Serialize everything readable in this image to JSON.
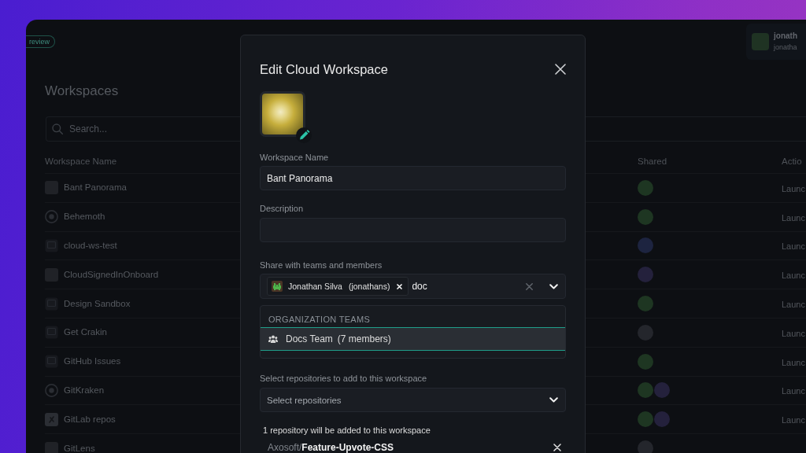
{
  "header": {
    "tag": "review",
    "user": {
      "name": "jonath",
      "handle": "jonatha"
    }
  },
  "page": {
    "title": "Workspaces",
    "search": {
      "placeholder": "Search..."
    }
  },
  "table": {
    "columns": [
      "Workspace Name",
      "Shared",
      "Actio"
    ],
    "rows": [
      {
        "name": "Bant Panorama",
        "kind": "photo",
        "shared": [
          {
            "color": "#1e3622"
          }
        ],
        "action": "Launc"
      },
      {
        "name": "Behemoth",
        "kind": "ring",
        "shared": [
          {
            "color": "#1e3622"
          }
        ],
        "action": "Launc"
      },
      {
        "name": "cloud-ws-test",
        "kind": "box",
        "shared": [
          {
            "color": "#1d2440"
          }
        ],
        "action": "Launc"
      },
      {
        "name": "CloudSignedInOnboard",
        "kind": "photo",
        "shared": [
          {
            "color": "#24213c"
          }
        ],
        "action": "Launc"
      },
      {
        "name": "Design Sandbox",
        "kind": "box",
        "shared": [
          {
            "color": "#1e3622"
          }
        ],
        "action": "Launc"
      },
      {
        "name": "Get Crakin",
        "kind": "box",
        "shared": [
          {
            "color": "#24262c"
          }
        ],
        "action": "Launc"
      },
      {
        "name": "GitHub Issues",
        "kind": "box",
        "shared": [
          {
            "color": "#1e3622"
          }
        ],
        "action": "Launc"
      },
      {
        "name": "GitKraken",
        "kind": "ring",
        "shared": [
          {
            "color": "#1e3622"
          },
          {
            "color": "#24213c"
          }
        ],
        "action": "Launc"
      },
      {
        "name": "GitLab repos",
        "kind": "tile",
        "shared": [
          {
            "color": "#1e3622"
          },
          {
            "color": "#24213c"
          }
        ],
        "action": "Launc"
      },
      {
        "name": "GitLens",
        "kind": "photo",
        "shared": [
          {
            "color": "#24262c"
          }
        ]
      }
    ]
  },
  "dialog": {
    "title": "Edit Cloud Workspace",
    "name_field": {
      "label": "Workspace Name",
      "value": "Bant Panorama"
    },
    "description_field": {
      "label": "Description"
    },
    "share": {
      "label": "Share with teams and members",
      "chips": [
        {
          "name": "Jonathan Silva",
          "handle": "(jonathans)"
        }
      ],
      "query": "doc",
      "expanded": true,
      "menu": {
        "heading": "ORGANIZATION TEAMS",
        "options": [
          {
            "name": "Docs Team",
            "detail": "(7 members)",
            "selected": true
          }
        ]
      }
    },
    "repositories": {
      "label": "Select repositories to add to this workspace",
      "placeholder": "Select repositories",
      "summary": "1 repository will be added to this workspace",
      "items": [
        {
          "owner": "Axosoft/",
          "name": "Feature-Upvote-CSS"
        }
      ]
    }
  }
}
